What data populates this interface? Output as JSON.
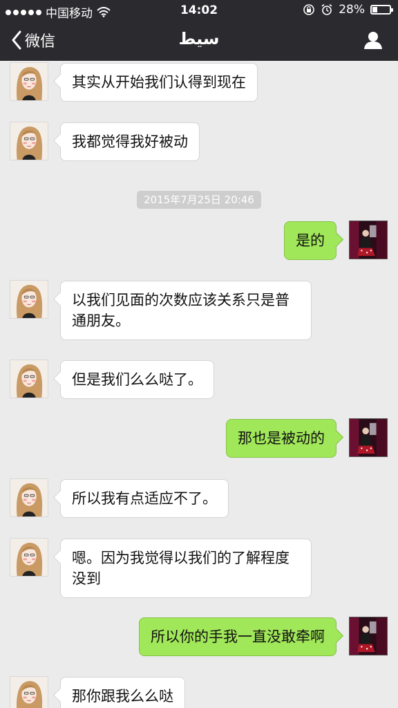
{
  "status_bar": {
    "carrier": "中国移动",
    "time": "14:02",
    "battery_percent": "28%",
    "battery_level": 0.28
  },
  "nav": {
    "back_label": "微信",
    "title": "سيط"
  },
  "messages": [
    {
      "text": "其实从开始我们认得到现在"
    },
    {
      "text": "我都觉得我好被动"
    },
    {
      "timestamp": "2015年7月25日 20:46"
    },
    {
      "text": "是的"
    },
    {
      "line1": "以我们见面的次数应该关系只是普",
      "line2": "通朋友。"
    },
    {
      "text": "但是我们么么哒了。"
    },
    {
      "text": "那也是被动的"
    },
    {
      "text": "所以我有点适应不了。"
    },
    {
      "line1": "嗯。因为我觉得以我们的了解程度",
      "line2": "没到"
    },
    {
      "text": "所以你的手我一直没敢牵啊"
    },
    {
      "text": "那你跟我么么哒"
    }
  ],
  "colors": {
    "header_bg": "#2b2b2f",
    "chat_bg": "#ebebeb",
    "outgoing_bubble": "#a0e759",
    "incoming_bubble": "#ffffff",
    "timestamp_bg": "#cecece"
  }
}
